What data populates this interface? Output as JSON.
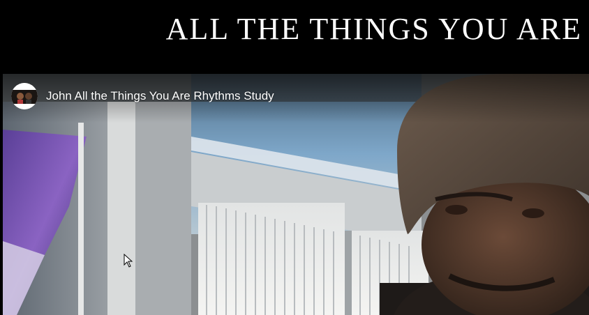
{
  "page": {
    "heading": "ALL THE THINGS YOU ARE",
    "background_color": "#000000",
    "heading_color": "#ffffff"
  },
  "video": {
    "title": "John All the Things You Are Rhythms Study",
    "channel_avatar_icon": "channel-avatar-icon",
    "cursor_icon": "mouse-pointer-icon"
  }
}
